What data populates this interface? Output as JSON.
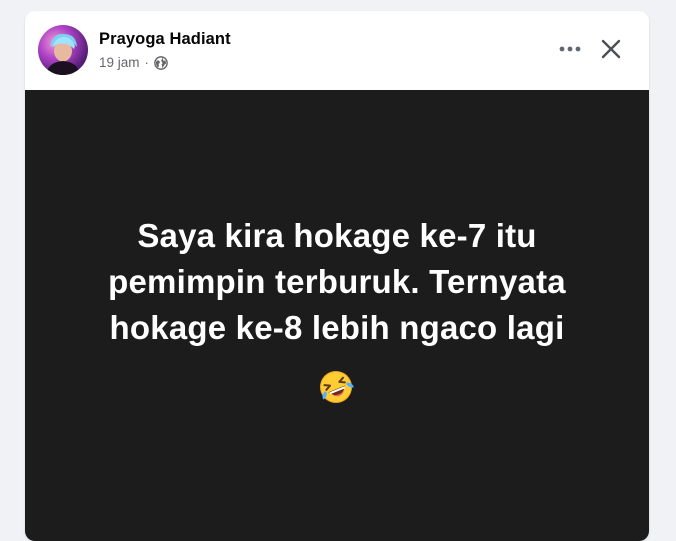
{
  "post": {
    "author_name": "Prayoga Hadiant",
    "timestamp": "19 jam",
    "separator": "·",
    "privacy_icon": "globe-icon",
    "text": "Saya kira hokage ke-7 itu pemimpin terburuk. Ternyata hokage ke-8 lebih ngaco lagi",
    "emoji": "rolling-on-floor-laughing-emoji",
    "background_color": "#1c1c1c",
    "text_color": "#ffffff"
  },
  "actions": {
    "more_icon": "more-options-icon",
    "close_icon": "close-icon"
  }
}
